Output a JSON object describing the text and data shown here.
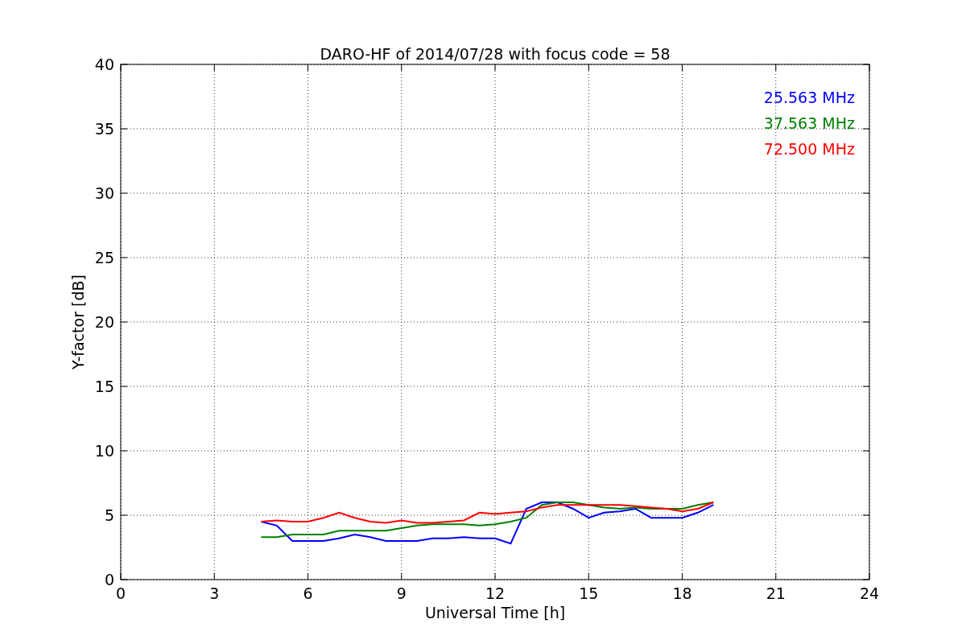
{
  "chart_data": {
    "type": "line",
    "title": "DARO-HF of 2014/07/28 with focus code = 58",
    "xlabel": "Universal Time [h]",
    "ylabel": "Y-factor [dB]",
    "x": [
      4.5,
      5,
      5.5,
      6,
      6.5,
      7,
      7.5,
      8,
      8.5,
      9,
      9.5,
      10,
      10.5,
      11,
      11.5,
      12,
      12.5,
      13,
      13.5,
      14,
      14.5,
      15,
      15.5,
      16,
      16.5,
      17,
      17.5,
      18,
      18.5,
      19
    ],
    "series": [
      {
        "name": "25.563 MHz",
        "color": "#0000ff",
        "values": [
          4.5,
          4.2,
          3,
          3,
          3,
          3.2,
          3.5,
          3.3,
          3,
          3,
          3,
          3.2,
          3.2,
          3.3,
          3.2,
          3.2,
          2.8,
          5.5,
          6,
          6,
          5.5,
          4.8,
          5.2,
          5.3,
          5.5,
          4.8,
          4.8,
          4.8,
          5.2,
          5.8
        ]
      },
      {
        "name": "37.563 MHz",
        "color": "#008000",
        "values": [
          3.3,
          3.3,
          3.5,
          3.5,
          3.5,
          3.8,
          3.8,
          3.8,
          3.8,
          4,
          4.2,
          4.3,
          4.3,
          4.3,
          4.2,
          4.3,
          4.5,
          4.8,
          5.8,
          6,
          6,
          5.8,
          5.6,
          5.5,
          5.6,
          5.5,
          5.5,
          5.5,
          5.8,
          6
        ]
      },
      {
        "name": "72.500 MHz",
        "color": "#ff0000",
        "values": [
          4.5,
          4.6,
          4.5,
          4.5,
          4.8,
          5.2,
          4.8,
          4.5,
          4.4,
          4.6,
          4.4,
          4.4,
          4.5,
          4.6,
          5.2,
          5.1,
          5.2,
          5.3,
          5.6,
          5.8,
          5.8,
          5.8,
          5.8,
          5.8,
          5.7,
          5.6,
          5.5,
          5.3,
          5.5,
          6
        ]
      }
    ],
    "grid": true,
    "xlim": [
      0,
      24
    ],
    "ylim": [
      0,
      40
    ],
    "xticks": [
      0,
      3,
      6,
      9,
      12,
      15,
      18,
      21,
      24
    ],
    "yticks": [
      0,
      5,
      10,
      15,
      20,
      25,
      30,
      35,
      40
    ]
  }
}
